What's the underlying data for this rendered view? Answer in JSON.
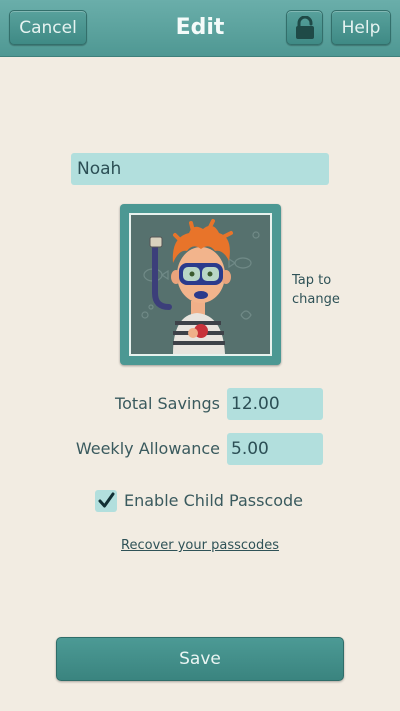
{
  "header": {
    "cancel_label": "Cancel",
    "title": "Edit",
    "help_label": "Help",
    "lock_icon": "lock-open-icon"
  },
  "profile": {
    "name_value": "Noah",
    "avatar_hint": "Tap to change"
  },
  "fields": {
    "total_savings_label": "Total Savings",
    "total_savings_value": "12.00",
    "weekly_allowance_label": "Weekly Allowance",
    "weekly_allowance_value": "5.00"
  },
  "passcode": {
    "enable_label": "Enable Child Passcode",
    "checked": true,
    "recover_link": "Recover your passcodes"
  },
  "footer": {
    "save_label": "Save"
  },
  "colors": {
    "accent": "#4c9893",
    "field_bg": "#b2dfdd",
    "page_bg": "#f2ece2"
  }
}
